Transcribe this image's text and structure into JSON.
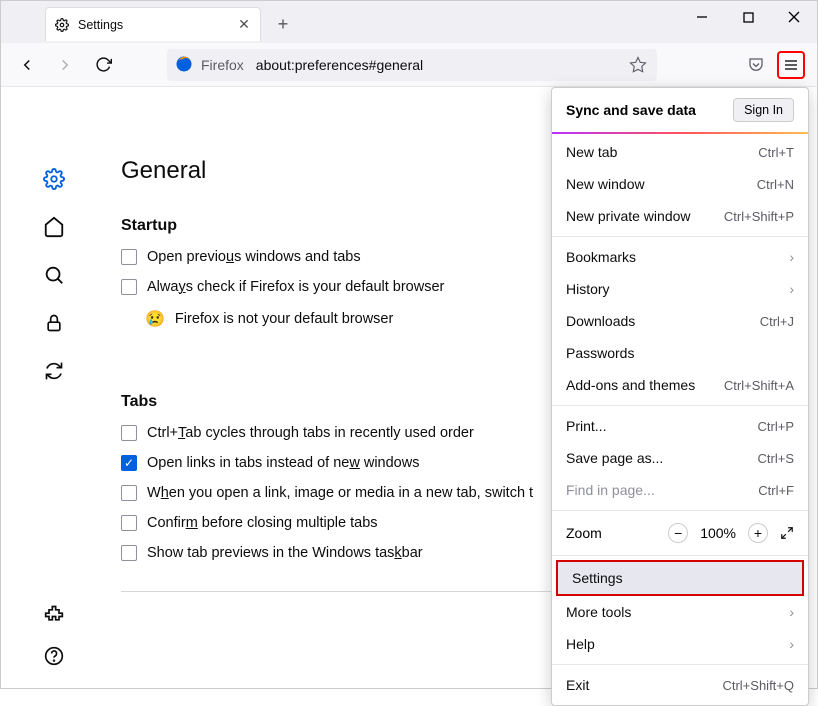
{
  "window": {
    "tab_title": "Settings",
    "identity_label": "Firefox",
    "url": "about:preferences#general"
  },
  "sidebar": {
    "items": [
      "general",
      "home",
      "search",
      "privacy",
      "sync"
    ],
    "bottom": [
      "extensions",
      "help"
    ]
  },
  "page": {
    "heading": "General",
    "startup_heading": "Startup",
    "startup_prev_label_pre": "Open previo",
    "startup_prev_label_u": "u",
    "startup_prev_label_post": "s windows and tabs",
    "startup_default_label_pre": "Alwa",
    "startup_default_label_u": "y",
    "startup_default_label_post": "s check if Firefox is your default browser",
    "default_status": "Firefox is not your default browser",
    "tabs_heading": "Tabs",
    "tabs_ctrl_label_pre": "Ctrl+",
    "tabs_ctrl_label_u": "T",
    "tabs_ctrl_label_post": "ab cycles through tabs in recently used order",
    "tabs_openlinks_label_pre": "Open links in tabs instead of ne",
    "tabs_openlinks_label_u": "w",
    "tabs_openlinks_label_post": " windows",
    "tabs_switch_label_pre": "W",
    "tabs_switch_label_u": "h",
    "tabs_switch_label_post": "en you open a link, image or media in a new tab, switch t",
    "tabs_confirm_label_pre": "Confir",
    "tabs_confirm_label_u": "m",
    "tabs_confirm_label_post": " before closing multiple tabs",
    "tabs_preview_label_pre": "Show tab previews in the Windows tas",
    "tabs_preview_label_u": "k",
    "tabs_preview_label_post": "bar"
  },
  "menu": {
    "sync_label": "Sync and save data",
    "signin": "Sign In",
    "newtab": "New tab",
    "newtab_sc": "Ctrl+T",
    "newwin": "New window",
    "newwin_sc": "Ctrl+N",
    "newpriv": "New private window",
    "newpriv_sc": "Ctrl+Shift+P",
    "bookmarks": "Bookmarks",
    "history": "History",
    "downloads": "Downloads",
    "downloads_sc": "Ctrl+J",
    "passwords": "Passwords",
    "addons": "Add-ons and themes",
    "addons_sc": "Ctrl+Shift+A",
    "print": "Print...",
    "print_sc": "Ctrl+P",
    "save": "Save page as...",
    "save_sc": "Ctrl+S",
    "find": "Find in page...",
    "find_sc": "Ctrl+F",
    "zoom": "Zoom",
    "zoom_val": "100%",
    "settings": "Settings",
    "more": "More tools",
    "help": "Help",
    "exit": "Exit",
    "exit_sc": "Ctrl+Shift+Q"
  }
}
